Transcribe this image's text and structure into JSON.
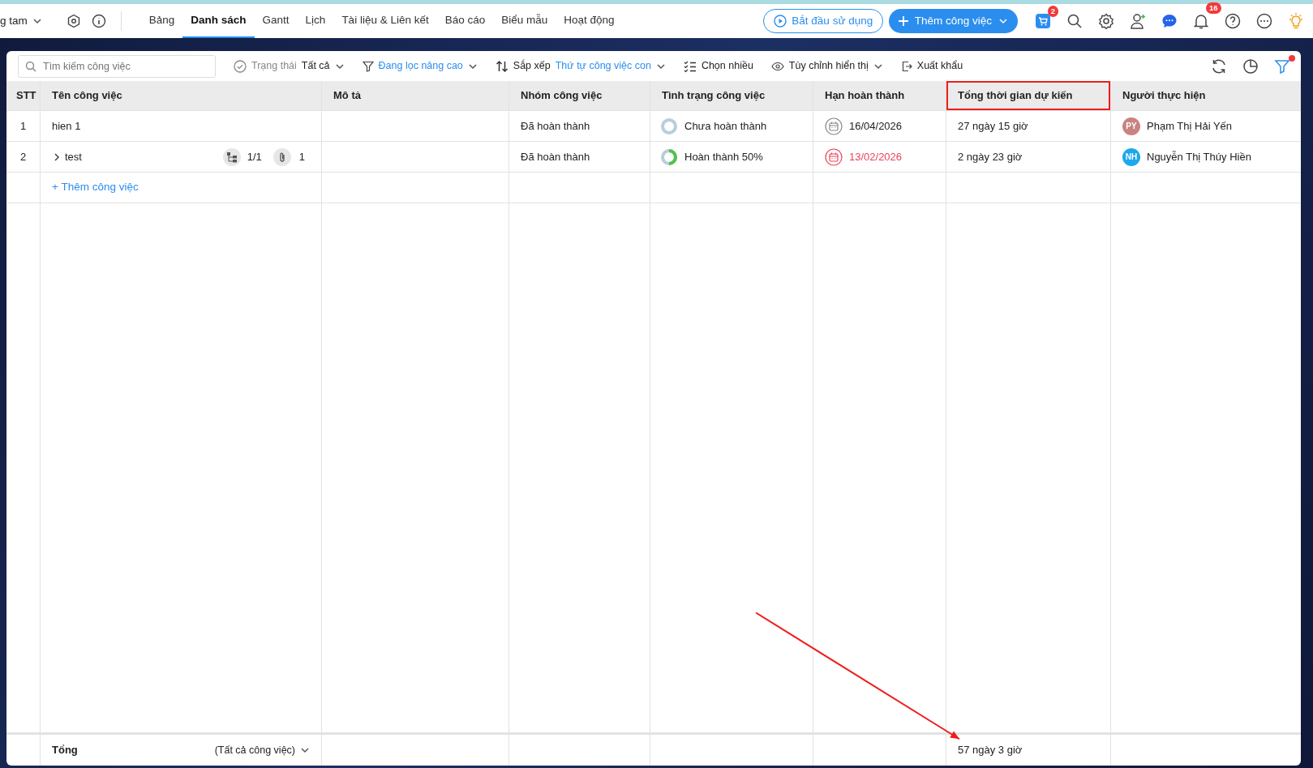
{
  "project_menu": {
    "label": "g tam"
  },
  "tabs": [
    {
      "label": "Bảng",
      "selected": false
    },
    {
      "label": "Danh sách",
      "selected": true
    },
    {
      "label": "Gantt",
      "selected": false
    },
    {
      "label": "Lịch",
      "selected": false
    },
    {
      "label": "Tài liệu & Liên kết",
      "selected": false
    },
    {
      "label": "Báo cáo",
      "selected": false
    },
    {
      "label": "Biểu mẫu",
      "selected": false
    },
    {
      "label": "Hoạt động",
      "selected": false
    }
  ],
  "start_button": {
    "label": "Bắt đầu sử dụng"
  },
  "add_button": {
    "label": "Thêm công việc"
  },
  "cart_badge": "2",
  "notification_badge": "16",
  "toolbar": {
    "search": {
      "placeholder": "Tìm kiếm công việc"
    },
    "status_label": "Trạng thái",
    "status_value": "Tất cả",
    "filter": "Đang lọc nâng cao",
    "sort_label": "Sắp xếp",
    "sort_value": "Thứ tự công việc con",
    "multi_select": "Chọn nhiều",
    "customize": "Tùy chỉnh hiển thị",
    "export": "Xuất khẩu",
    "filter_active": true
  },
  "table": {
    "columns": [
      {
        "label": "STT",
        "highlighted": false
      },
      {
        "label": "Tên công việc",
        "highlighted": false
      },
      {
        "label": "Mô tả",
        "highlighted": false
      },
      {
        "label": "Nhóm công việc",
        "highlighted": false
      },
      {
        "label": "Tình trạng công việc",
        "highlighted": false
      },
      {
        "label": "Hạn hoàn thành",
        "highlighted": false
      },
      {
        "label": "Tổng thời gian dự kiến",
        "highlighted": true
      },
      {
        "label": "Người thực hiện",
        "highlighted": false
      }
    ],
    "rows": [
      {
        "index": "1",
        "name": "hien 1",
        "group": "Đã hoàn thành",
        "status": "Chưa hoàn thành",
        "due": "16/04/2026",
        "overdue": false,
        "duration": "27 ngày 15 giờ",
        "assignee_initials": "PY",
        "color": "#c98383",
        "assignee": "Phạm Thị Hải Yến"
      },
      {
        "index": "2",
        "name": "test",
        "expanded": false,
        "subtasks": "1/1",
        "attachments": "1",
        "group": "Đã hoàn thành",
        "status": "Hoàn thành 50%",
        "level": 0.5,
        "due": "13/02/2026",
        "overdue": true,
        "duration": "2 ngày 23 giờ",
        "assignee_initials": "NH",
        "color": "#1ea7ec",
        "assignee": "Nguyễn Thị Thúy Hiền"
      }
    ],
    "add_task": "+ Thêm công việc",
    "footer": {
      "label": "Tổng",
      "scope": "(Tất cả công việc)",
      "total_duration": "57 ngày 3 giờ"
    }
  }
}
